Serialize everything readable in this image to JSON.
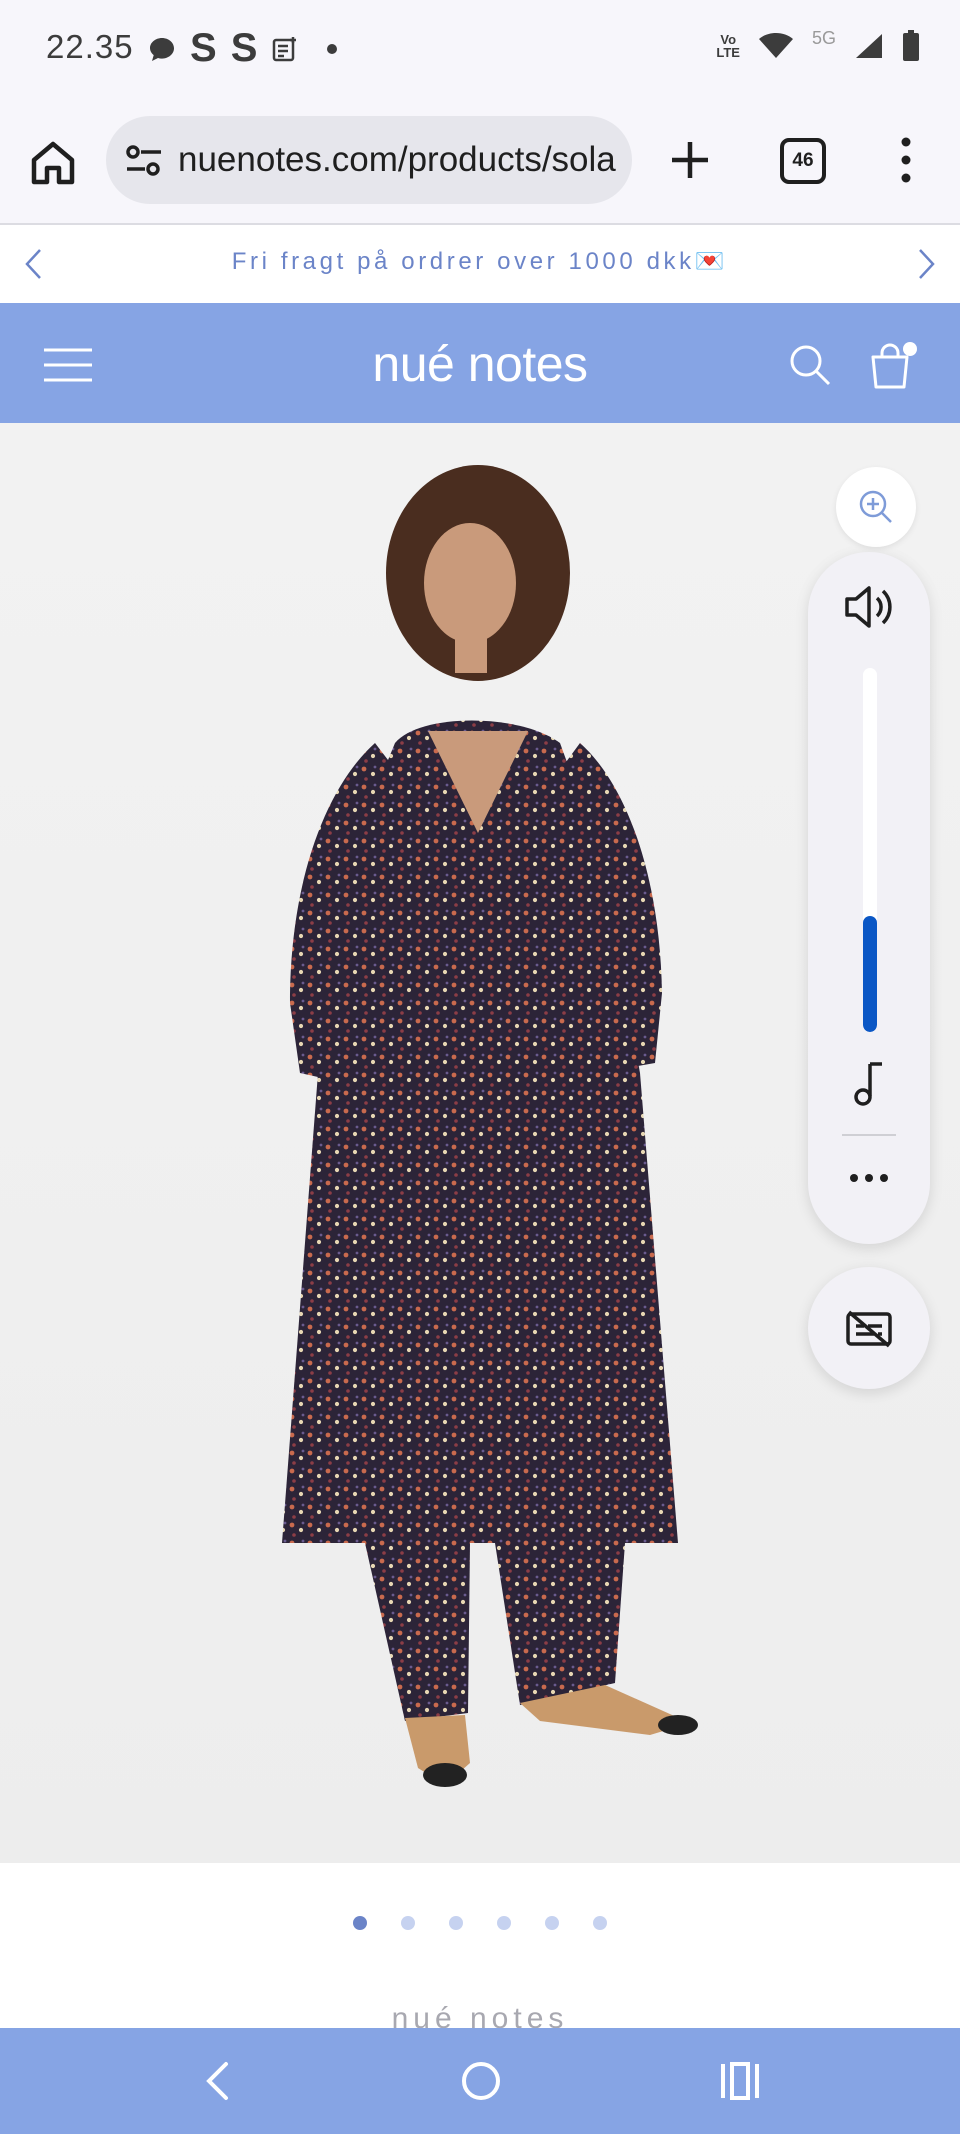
{
  "status_bar": {
    "time": "22.35",
    "s_icon_1": "S",
    "s_icon_2": "S",
    "volte_line1": "Vo",
    "volte_line2": "LTE",
    "network": "5G"
  },
  "browser": {
    "url": "nuenotes.com/products/solaris-dress",
    "tab_count": "46"
  },
  "announcement": {
    "text": "Fri fragt på ordrer over 1000 dkk💌"
  },
  "header": {
    "logo": "nué notes",
    "cart_badge_color": "#ffffff"
  },
  "colors": {
    "header_bg": "#86a4e4",
    "accent_text": "#6b84c8",
    "volume_fill": "#0b57c5"
  },
  "volume_overlay": {
    "level": 0.32,
    "more_label": "•••"
  },
  "pager": {
    "total": 6,
    "active_index": 0
  },
  "footer": {
    "peek_text": "nué notes"
  },
  "icons": [
    "home-icon",
    "site-settings-icon",
    "new-tab-icon",
    "tab-switcher-icon",
    "overflow-menu-icon",
    "chevron-left-icon",
    "chevron-right-icon",
    "hamburger-icon",
    "search-icon",
    "cart-icon",
    "zoom-in-icon",
    "speaker-icon",
    "music-note-icon",
    "captions-off-icon",
    "nav-back-icon",
    "nav-home-icon",
    "nav-recents-icon"
  ]
}
